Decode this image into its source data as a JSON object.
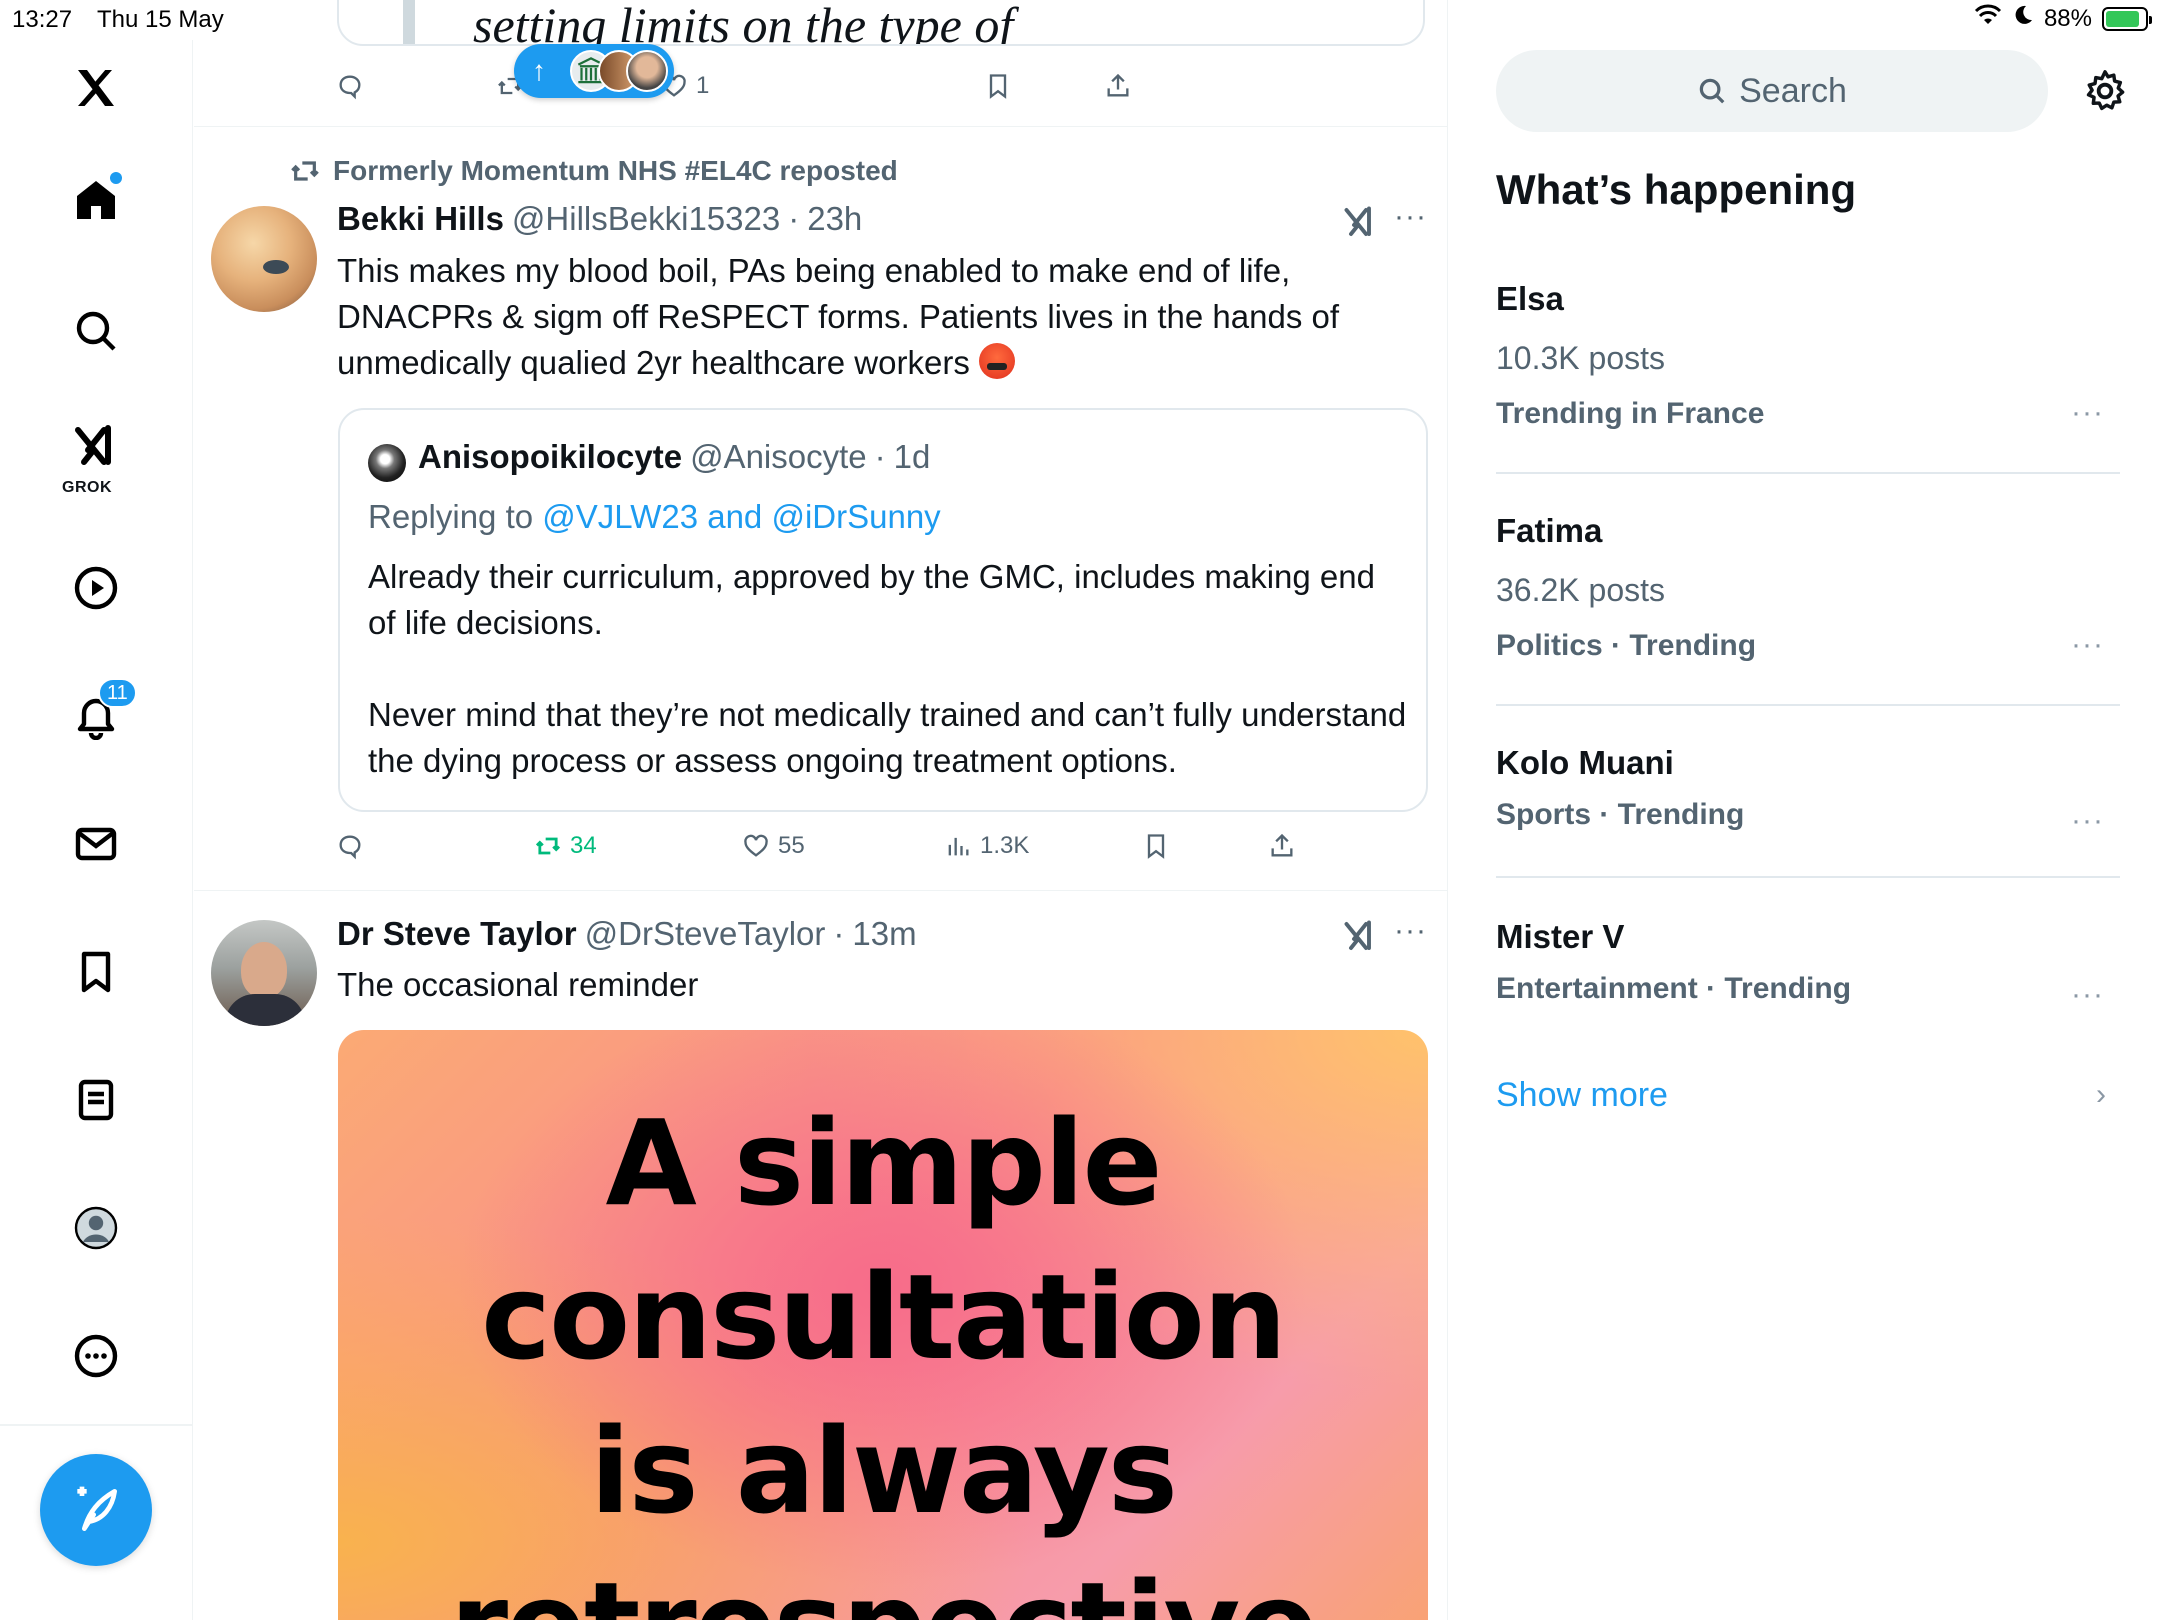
{
  "status_bar": {
    "time": "13:27",
    "date": "Thu 15 May",
    "battery": "88%",
    "battery_level": 0.88
  },
  "nav": {
    "grok_label": "GROK",
    "notifications_badge": "11",
    "icons": [
      "x-logo-icon",
      "home-icon",
      "search-icon",
      "grok-icon",
      "video-icon",
      "bell-icon",
      "mail-icon",
      "bookmark-icon",
      "lists-icon",
      "profile-icon",
      "more-icon",
      "compose-icon"
    ]
  },
  "colors": {
    "accent": "#1d9bf0",
    "retweet_green": "#00ba7c",
    "secondary_text": "#536471"
  },
  "feed": {
    "top_quote_text": "setting limits on the type of",
    "top_actions": {
      "like_count": "1"
    },
    "post1": {
      "repost_label": "Formerly Momentum NHS #EL4C reposted",
      "name": "Bekki Hills",
      "handle": "@HillsBekki15323",
      "sep": "·",
      "time": "23h",
      "text": "This makes my blood boil, PAs being enabled to make end of life, DNACPRs & sigm off ReSPECT forms. Patients lives in the hands of unmedically qualied 2yr healthcare workers",
      "quote": {
        "name": "Anisopoikilocyte",
        "handle": "@Anisocyte",
        "sep": "·",
        "time": "1d",
        "replying_prefix": "Replying to",
        "replying_to": "@VJLW23 and @iDrSunny",
        "paragraph1": "Already their curriculum, approved by the GMC, includes making end of life decisions.",
        "paragraph2": "Never mind that they’re not medically trained and can’t fully understand the dying process or assess ongoing treatment options."
      },
      "actions": {
        "retweets": "34",
        "likes": "55",
        "views": "1.3K"
      }
    },
    "post2": {
      "name": "Dr Steve Taylor",
      "handle": "@DrSteveTaylor",
      "sep": "·",
      "time": "13m",
      "text": "The occasional reminder",
      "image_lines": [
        "A simple",
        "consultation",
        "is always",
        "retrospective"
      ]
    }
  },
  "sidebar": {
    "search_placeholder": "Search",
    "heading": "What’s happening",
    "trends": [
      {
        "name": "Elsa",
        "count": "10.3K posts",
        "meta": "Trending in France"
      },
      {
        "name": "Fatima",
        "count": "36.2K posts",
        "meta": "Politics · Trending"
      },
      {
        "name": "Kolo Muani",
        "count": "",
        "meta": "Sports · Trending"
      },
      {
        "name": "Mister V",
        "count": "",
        "meta": "Entertainment · Trending"
      }
    ],
    "show_more": "Show more"
  }
}
